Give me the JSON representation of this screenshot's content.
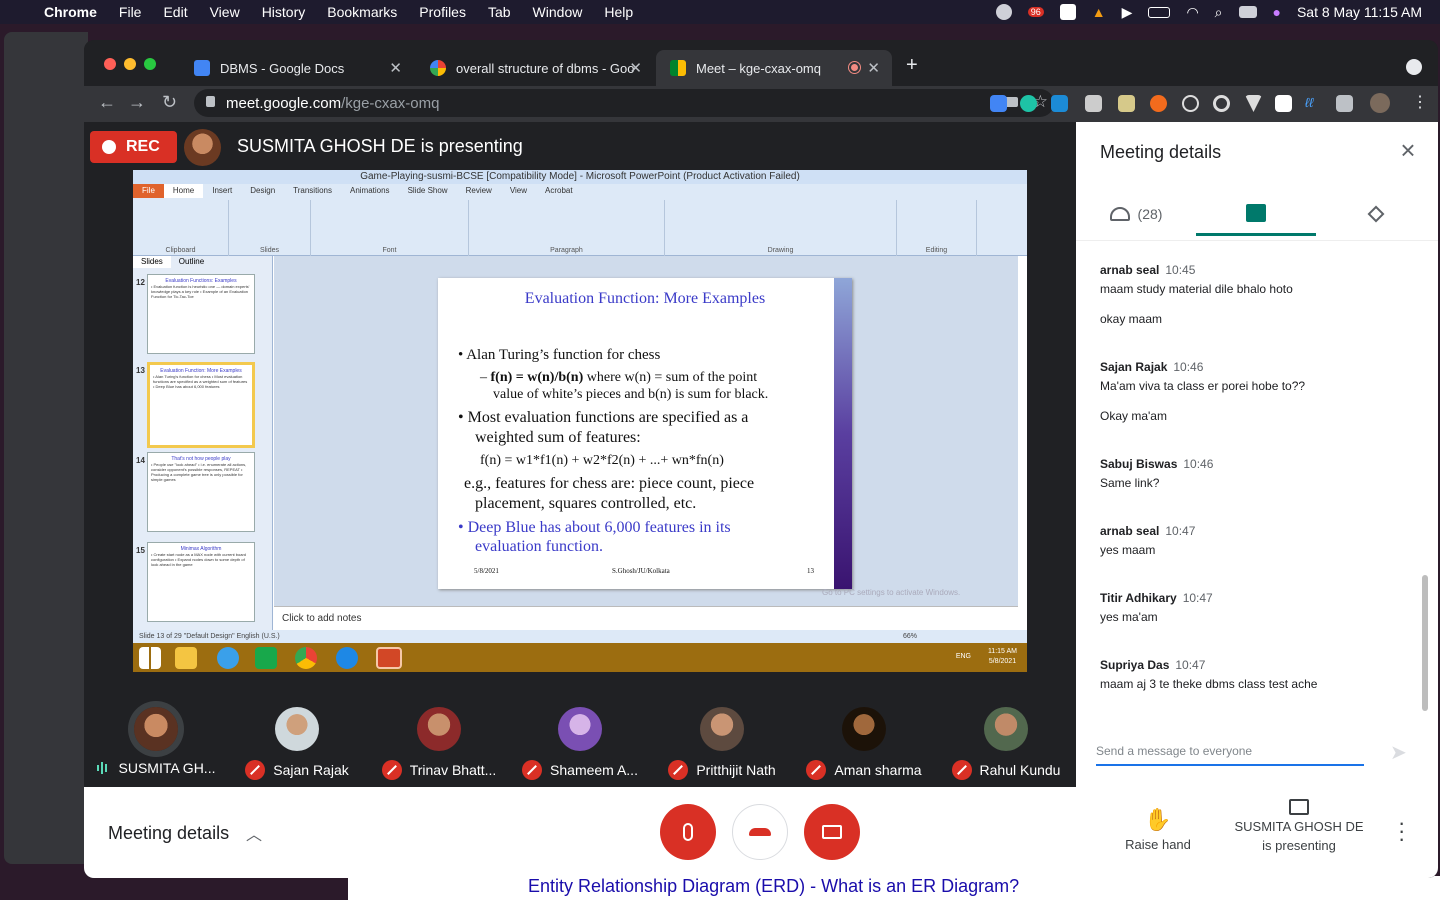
{
  "menubar": {
    "apple": "",
    "items": [
      "Chrome",
      "File",
      "Edit",
      "View",
      "History",
      "Bookmarks",
      "Profiles",
      "Tab",
      "Window",
      "Help"
    ],
    "badge": "96",
    "datetime": "Sat 8 May  11:15 AM"
  },
  "tabs": [
    {
      "title": "DBMS - Google Docs",
      "color": "#4285f4"
    },
    {
      "title": "overall structure of dbms - Goo",
      "color": "#ea4335"
    },
    {
      "title": "Meet – kge-cxax-omq",
      "color": "#00832d"
    }
  ],
  "omnibox": {
    "host": "meet.google.com",
    "path": "/kge-cxax-omq"
  },
  "meet": {
    "rec_label": "REC",
    "presenting": "SUSMITA GHOSH DE is presenting"
  },
  "ppt": {
    "window_title": "Game-Playing-susmi-BCSE [Compatibility Mode] - Microsoft PowerPoint (Product Activation Failed)",
    "ribbon_tabs": [
      "File",
      "Home",
      "Insert",
      "Design",
      "Transitions",
      "Animations",
      "Slide Show",
      "Review",
      "View",
      "Acrobat"
    ],
    "groups": [
      "Clipboard",
      "Slides",
      "Font",
      "Paragraph",
      "Drawing",
      "Editing"
    ],
    "pane_tabs": [
      "Slides",
      "Outline"
    ],
    "notes": "Click to add notes",
    "status": "Slide 13 of 29   \"Default Design\"   English (U.S.)",
    "zoom": "66%",
    "activate": "Go to PC settings to activate Windows.",
    "clock_time": "11:15 AM",
    "clock_date": "5/8/2021",
    "lang": "ENG"
  },
  "thumbs": [
    {
      "num": "12",
      "title": "Evaluation Functions: Examples",
      "body": "• Evaluation function is heuristic one — domain experts' knowledge plays a key role • Example of an Evaluation Function for Tic-Tac-Toe"
    },
    {
      "num": "13",
      "title": "Evaluation Function: More Examples",
      "body": "• Alan Turing's function for chess • Most evaluation functions are specified as a weighted sum of features • Deep Blue has about 6,000 features"
    },
    {
      "num": "14",
      "title": "That's not how people play",
      "body": "• People use \"look ahead\" • i.e. enumerate all actions, consider opponent's possible responses, REPEAT • Producing a complete game tree is only possible for simple games"
    },
    {
      "num": "15",
      "title": "Minimax Algorithm",
      "body": "• Create start node as a MAX node with current board configuration • Expand nodes down to some depth of look ahead in the game"
    }
  ],
  "slide": {
    "title": "Evaluation Function: More Examples",
    "b1": "Alan Turing’s  function for chess",
    "b1a_bold": "f(n) = w(n)/b(n)",
    "b1a_rest": " where w(n) = sum of the point",
    "b1a_cont": "value of white’s pieces and b(n) is sum for black.",
    "b2": "Most  evaluation  functions  are  specified  as  a",
    "b2_cont": "weighted sum of  features:",
    "formula": "f(n) = w1*f1(n) + w2*f2(n) + ...+ wn*fn(n)",
    "eg": "e.g., features for chess are: piece count,   piece",
    "eg_cont": "placement, squares controlled, etc.",
    "b3": "Deep  Blue  has  about  6,000  features  in  its",
    "b3_cont": "evaluation function.",
    "footer_date": "5/8/2021",
    "footer_author": "S.Ghosh/JU/Kolkata",
    "footer_page": "13"
  },
  "participants": [
    {
      "name": "SUSMITA GH...",
      "speaking": true
    },
    {
      "name": "Sajan Rajak",
      "speaking": false
    },
    {
      "name": "Trinav Bhatt...",
      "speaking": false
    },
    {
      "name": "Shameem A...",
      "speaking": false
    },
    {
      "name": "Pritthijit Nath",
      "speaking": false
    },
    {
      "name": "Aman sharma",
      "speaking": false
    },
    {
      "name": "Rahul Kundu",
      "speaking": false
    }
  ],
  "panel": {
    "title": "Meeting details",
    "people_count": "(28)",
    "send_placeholder": "Send a message to everyone"
  },
  "chat": [
    {
      "who": "arnab seal",
      "time": "10:45",
      "lines": [
        "maam study material dile bhalo hoto",
        "okay maam"
      ]
    },
    {
      "who": "Sajan Rajak",
      "time": "10:46",
      "lines": [
        "Ma'am viva ta class er porei hobe to??",
        "Okay ma'am"
      ]
    },
    {
      "who": "Sabuj Biswas",
      "time": "10:46",
      "lines": [
        "Same link?"
      ]
    },
    {
      "who": "arnab seal",
      "time": "10:47",
      "lines": [
        "yes maam"
      ]
    },
    {
      "who": "Titir Adhikary",
      "time": "10:47",
      "lines": [
        "yes ma'am"
      ]
    },
    {
      "who": "Supriya Das",
      "time": "10:47",
      "lines": [
        "maam aj 3 te theke dbms class test ache"
      ]
    }
  ],
  "bottombar": {
    "meeting_details": "Meeting details",
    "raise_hand": "Raise hand",
    "present_line1": "SUSMITA GHOSH DE",
    "present_line2": "is presenting"
  },
  "background_page": {
    "heading": "Entity Relationship Diagram (ERD) - What is an ER Diagram?"
  },
  "colors": {
    "meet_red": "#d93025",
    "accent_blue": "#1a73e8",
    "chat_tab": "#00796b"
  }
}
